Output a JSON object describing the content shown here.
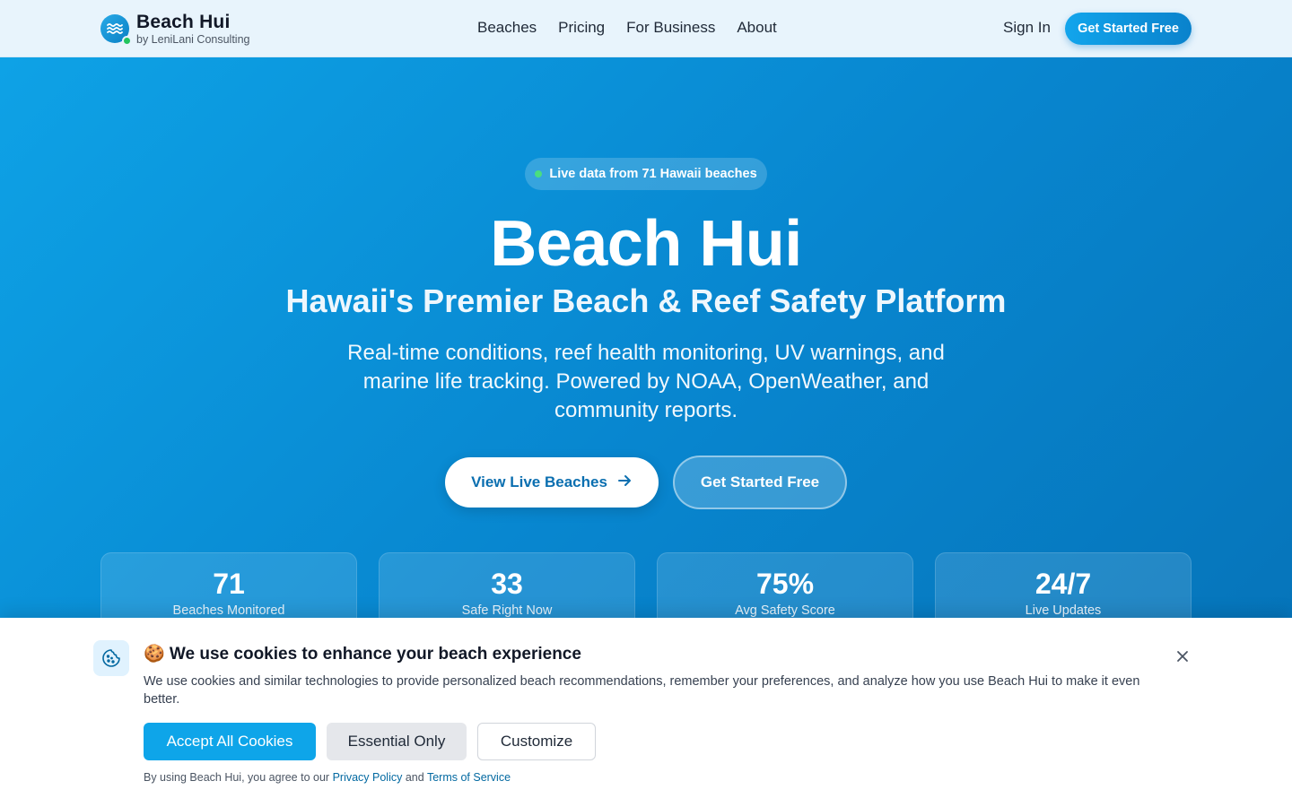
{
  "header": {
    "brand_name": "Beach Hui",
    "brand_sub": "by LeniLani Consulting",
    "nav": [
      "Beaches",
      "Pricing",
      "For Business",
      "About"
    ],
    "sign_in": "Sign In",
    "cta": "Get Started Free"
  },
  "hero": {
    "badge": "Live data from 71 Hawaii beaches",
    "title": "Beach Hui",
    "subtitle": "Hawaii's Premier Beach & Reef Safety Platform",
    "description": "Real-time conditions, reef health monitoring, UV warnings, and marine life tracking. Powered by NOAA, OpenWeather, and community reports.",
    "primary_button": "View Live Beaches",
    "secondary_button": "Get Started Free",
    "stats": [
      {
        "value": "71",
        "label": "Beaches Monitored"
      },
      {
        "value": "33",
        "label": "Safe Right Now"
      },
      {
        "value": "75%",
        "label": "Avg Safety Score"
      },
      {
        "value": "24/7",
        "label": "Live Updates"
      }
    ]
  },
  "cookie": {
    "title": "🍪 We use cookies to enhance your beach experience",
    "text": "We use cookies and similar technologies to provide personalized beach recommendations, remember your preferences, and analyze how you use Beach Hui to make it even better.",
    "accept": "Accept All Cookies",
    "essential": "Essential Only",
    "customize": "Customize",
    "legal_prefix": "By using Beach Hui, you agree to our",
    "privacy_link": "Privacy Policy",
    "legal_and": "and",
    "terms_link": "Terms of Service"
  },
  "colors": {
    "accent": "#0ea5e9",
    "hero_start": "#0ea2e6",
    "hero_end": "#0571b6",
    "live_dot": "#4ade80",
    "online_dot": "#22c55e"
  },
  "icons": [
    "waves-icon",
    "arrow-right-icon",
    "cookie-icon",
    "close-icon"
  ]
}
